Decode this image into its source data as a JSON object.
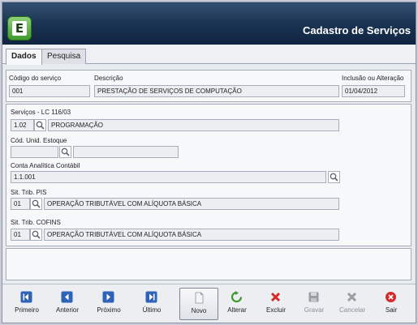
{
  "header": {
    "title": "Cadastro de Serviços",
    "logo_letter": "E"
  },
  "tabs": [
    {
      "label": "Dados",
      "active": true
    },
    {
      "label": "Pesquisa",
      "active": false
    }
  ],
  "top_fields": {
    "codigo": {
      "label": "Código do serviço",
      "value": "001"
    },
    "descricao": {
      "label": "Descrição",
      "value": "PRESTAÇÃO DE SERVIÇOS DE COMPUTAÇÃO"
    },
    "inclusao": {
      "label": "Inclusão ou Alteração",
      "value": "01/04/2012"
    }
  },
  "details": {
    "servicos": {
      "label": "Serviços - LC 116/03",
      "code": "1.02",
      "desc": "PROGRAMAÇÃO"
    },
    "unid_estoque": {
      "label": "Cód. Unid. Estoque",
      "code": "",
      "desc": ""
    },
    "conta": {
      "label": "Conta Analítica Contábil",
      "value": "1.1.001"
    },
    "pis": {
      "label": "Sit. Trib. PIS",
      "code": "01",
      "desc": "OPERAÇÃO TRIBUTÁVEL COM ALÍQUOTA BÁSICA"
    },
    "cofins": {
      "label": "Sit. Trib. COFINS",
      "code": "01",
      "desc": "OPERAÇÃO TRIBUTÁVEL COM ALÍQUOTA BÁSICA"
    }
  },
  "toolbar": {
    "primeiro": "Primeiro",
    "anterior": "Anterior",
    "proximo": "Próximo",
    "ultimo": "Último",
    "novo": "Novo",
    "alterar": "Alterar",
    "excluir": "Excluir",
    "gravar": "Gravar",
    "cancelar": "Cancelar",
    "sair": "Sair"
  },
  "colors": {
    "header_dark": "#1d3656",
    "nav_blue": "#2f63b8",
    "delete_red": "#d62a2a",
    "ok_green": "#3b9a2b",
    "disabled_gray": "#9a9da3"
  }
}
